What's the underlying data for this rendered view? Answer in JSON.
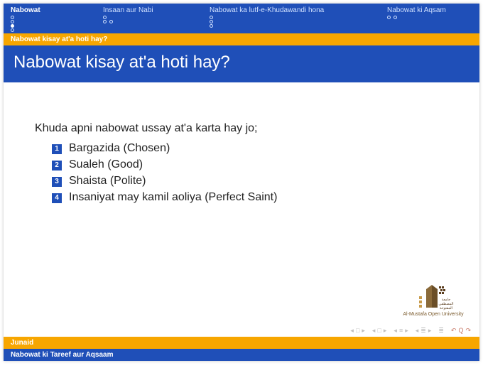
{
  "nav": {
    "sections": [
      {
        "title": "Nabowat",
        "current": true
      },
      {
        "title": "Insaan aur Nabi",
        "current": false
      },
      {
        "title": "Nabowat ka lutf-e-Khudawandi hona",
        "current": false
      },
      {
        "title": "Nabowat ki Aqsam",
        "current": false
      }
    ]
  },
  "subsection_bar": "Nabowat kisay at'a hoti hay?",
  "title": "Nabowat kisay at'a hoti hay?",
  "body": {
    "lead": "Khuda apni nabowat ussay at'a karta hay jo;",
    "items": [
      {
        "n": "1",
        "text": "Bargazida (Chosen)"
      },
      {
        "n": "2",
        "text": "Sualeh (Good)"
      },
      {
        "n": "3",
        "text": "Shaista (Polite)"
      },
      {
        "n": "4",
        "text": "Insaniyat may kamil aoliya (Perfect Saint)"
      }
    ]
  },
  "logo_caption": "Al-Mustafa Open University",
  "controls": {
    "first": "◂",
    "back_sec": "◂",
    "back": "◂",
    "fwd": "▸",
    "fwd_sec": "▸",
    "last": "▸",
    "box": "□",
    "dbl": "□",
    "undo": "↶",
    "redo": "↷"
  },
  "footer": {
    "author": "Junaid",
    "talk_title": "Nabowat ki Tareef aur Aqsaam"
  }
}
